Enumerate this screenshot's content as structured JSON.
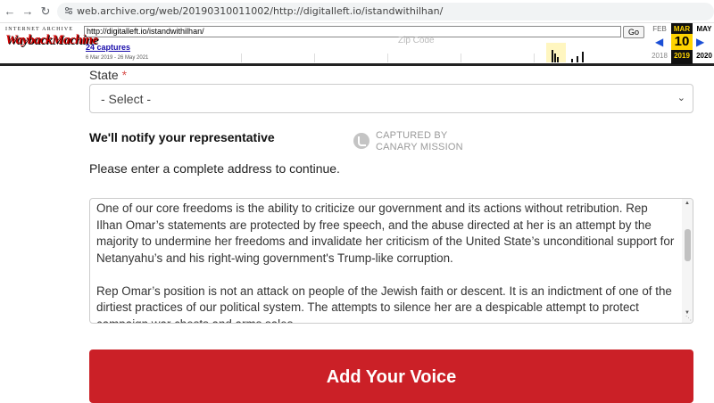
{
  "browser": {
    "url": "web.archive.org/web/20190310011002/http://digitalleft.io/istandwithilhan/"
  },
  "wayback": {
    "logo_top": "INTERNET ARCHIVE",
    "logo_bottom": "WaybackMachine",
    "url_field": "http://digitalleft.io/istandwithilhan/",
    "go_label": "Go",
    "captures": "24 captures",
    "range": "6 Mar 2019 - 26 May 2021",
    "calendar": {
      "prev": {
        "month": "FEB",
        "year": "2018"
      },
      "current": {
        "month": "MAR",
        "day": "10",
        "year": "2019"
      },
      "next": {
        "month": "MAY",
        "year": "2020"
      }
    }
  },
  "form": {
    "ghost_text": "Zip Code",
    "state_label": "State",
    "required_mark": "*",
    "state_select_value": "- Select -",
    "notify_heading": "We'll notify your representative",
    "watermark_line1": "CAPTURED BY",
    "watermark_line2": "CANARY MISSION",
    "instruction": "Please enter a complete address to continue.",
    "message_p1": "One of our core freedoms is the ability to criticize our government and its actions without retribution. Rep Ilhan Omar’s statements are protected by free speech, and the abuse directed at her is an attempt by the majority to undermine her freedoms and invalidate her criticism of the United State’s unconditional support for Netanyahu’s and his right-wing government's Trump-like corruption.",
    "message_p2": "Rep Omar’s position is not an attack on people of the Jewish faith or descent. It is an indictment of one of the dirtiest practices of our political system. The attempts to silence her are a despicable attempt to protect campaign war chests and arms sales.",
    "submit_label": "Add Your Voice"
  },
  "colors": {
    "submit_bg": "#cb2027",
    "calendar_highlight": "#ffd400",
    "required": "#d9534f"
  }
}
